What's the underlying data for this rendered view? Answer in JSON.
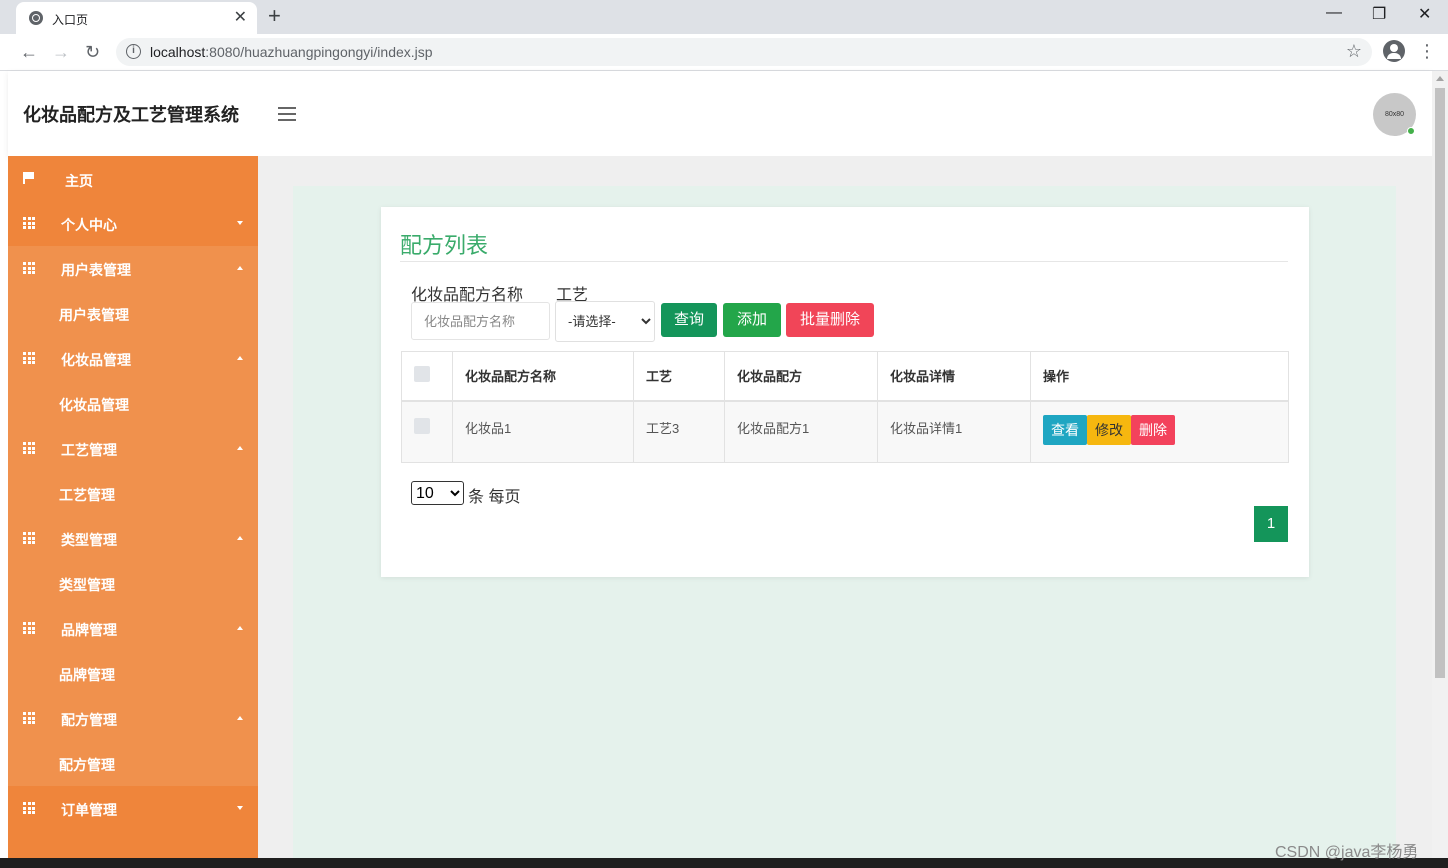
{
  "browser": {
    "tab_title": "入口页",
    "tab_close": "✕",
    "new_tab": "+",
    "url_host": "localhost",
    "url_path": ":8080/huazhuangpingongyi/index.jsp",
    "window_controls": [
      "—",
      "❐",
      "✕"
    ]
  },
  "header": {
    "system_title": "化妆品配方及工艺管理系统",
    "avatar_text": "80x80"
  },
  "sidebar": {
    "items": [
      {
        "label": "主页",
        "icon": "flag-icon",
        "type": "home"
      },
      {
        "label": "个人中心",
        "icon": "grid-icon",
        "type": "parent",
        "caret": "down"
      },
      {
        "label": "用户表管理",
        "icon": "grid-icon",
        "type": "parent-open",
        "caret": "up"
      },
      {
        "label": "用户表管理",
        "type": "sub"
      },
      {
        "label": "化妆品管理",
        "icon": "grid-icon",
        "type": "parent-open",
        "caret": "up"
      },
      {
        "label": "化妆品管理",
        "type": "sub"
      },
      {
        "label": "工艺管理",
        "icon": "grid-icon",
        "type": "parent-open",
        "caret": "up"
      },
      {
        "label": "工艺管理",
        "type": "sub"
      },
      {
        "label": "类型管理",
        "icon": "grid-icon",
        "type": "parent-open",
        "caret": "up"
      },
      {
        "label": "类型管理",
        "type": "sub"
      },
      {
        "label": "品牌管理",
        "icon": "grid-icon",
        "type": "parent-open",
        "caret": "up"
      },
      {
        "label": "品牌管理",
        "type": "sub"
      },
      {
        "label": "配方管理",
        "icon": "grid-icon",
        "type": "parent-open",
        "caret": "up"
      },
      {
        "label": "配方管理",
        "type": "sub"
      },
      {
        "label": "订单管理",
        "icon": "grid-icon",
        "type": "parent",
        "caret": "down"
      }
    ]
  },
  "main": {
    "card_title": "配方列表",
    "search": {
      "name_label": "化妆品配方名称",
      "name_placeholder": "化妆品配方名称",
      "name_value": "",
      "craft_label": "工艺",
      "craft_selected": "-请选择-"
    },
    "buttons": {
      "query": "查询",
      "add": "添加",
      "batch_delete": "批量删除"
    },
    "table": {
      "headers": [
        "化妆品配方名称",
        "工艺",
        "化妆品配方",
        "化妆品详情",
        "操作"
      ],
      "rows": [
        {
          "name": "化妆品1",
          "craft": "工艺3",
          "formula": "化妆品配方1",
          "detail": "化妆品详情1"
        }
      ],
      "row_actions": {
        "view": "查看",
        "edit": "修改",
        "delete": "删除"
      }
    },
    "pagination": {
      "page_size": "10",
      "page_size_suffix": "条 每页",
      "current_page": "1"
    }
  },
  "watermark": "CSDN @java李杨勇",
  "colors": {
    "sidebar": "#ef853b",
    "sidebar_open": "#f0914d",
    "title_green": "#3aab6b",
    "query_btn": "#14955a",
    "add_btn": "#23a64a",
    "delete_btn": "#f14558",
    "view_btn": "#1fa6c2",
    "edit_btn": "#f6b70f"
  }
}
